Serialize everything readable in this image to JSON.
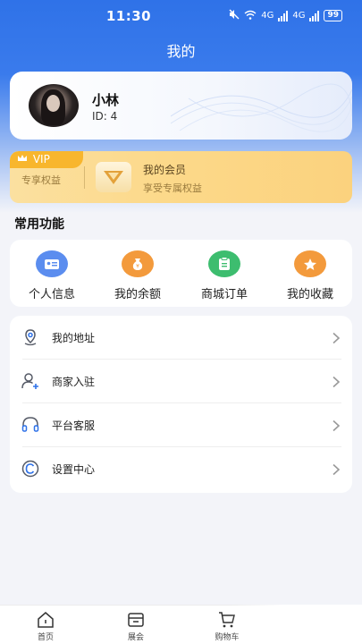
{
  "status_bar": {
    "time": "11:30",
    "signal_label_1": "4G",
    "signal_label_2": "4G",
    "battery": "99"
  },
  "header": {
    "title": "我的"
  },
  "profile": {
    "name": "小林",
    "id_text": "ID: 4"
  },
  "vip": {
    "tag": "VIP",
    "left_text": "专享权益",
    "title": "我的会员",
    "subtitle": "享受专属权益"
  },
  "common_section": {
    "title": "常用功能",
    "items": [
      {
        "label": "个人信息",
        "icon": "id-card-icon",
        "color": "#5b8def"
      },
      {
        "label": "我的余额",
        "icon": "money-bag-icon",
        "color": "#f39a3c"
      },
      {
        "label": "商城订单",
        "icon": "order-clipboard-icon",
        "color": "#3dbd6f"
      },
      {
        "label": "我的收藏",
        "icon": "star-icon",
        "color": "#f39a3c"
      }
    ]
  },
  "menu": {
    "items": [
      {
        "label": "我的地址",
        "icon": "location-pin-icon"
      },
      {
        "label": "商家入驻",
        "icon": "user-add-icon"
      },
      {
        "label": "平台客服",
        "icon": "headset-icon"
      },
      {
        "label": "设置中心",
        "icon": "copyright-c-icon"
      }
    ]
  },
  "tab_bar": {
    "items": [
      {
        "label": "首页",
        "icon": "home-icon"
      },
      {
        "label": "展会",
        "icon": "exhibition-box-icon"
      },
      {
        "label": "购物车",
        "icon": "cart-icon"
      }
    ]
  },
  "colors": {
    "primary": "#2f72e8",
    "vip_gold": "#f8b62d",
    "background": "#f3f4f9"
  }
}
